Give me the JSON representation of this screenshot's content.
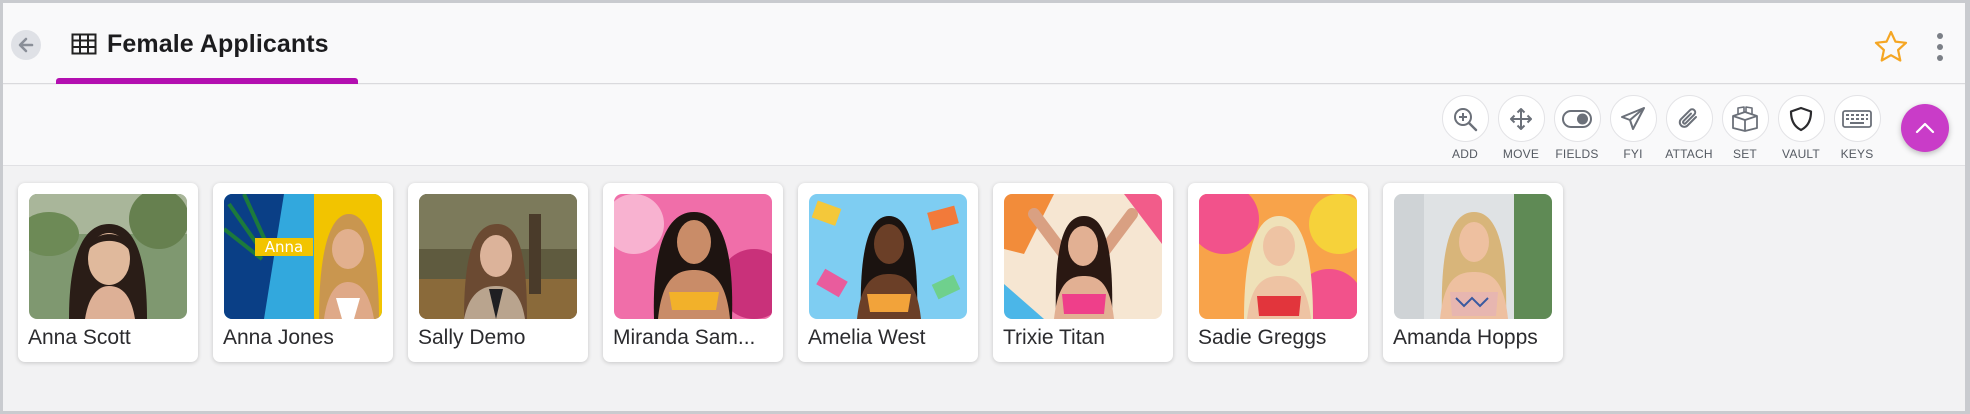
{
  "header": {
    "title": "Female Applicants",
    "icons": {
      "back": "arrow-left-icon",
      "table": "table-grid-icon",
      "star": "star-outline-icon",
      "more": "kebab-menu-icon"
    },
    "colors": {
      "accent": "#b30fb0",
      "star": "#f5a623"
    }
  },
  "toolbar": {
    "actions": [
      {
        "label": "ADD",
        "icon": "zoom-in-icon"
      },
      {
        "label": "MOVE",
        "icon": "move-arrows-icon"
      },
      {
        "label": "FIELDS",
        "icon": "toggle-icon"
      },
      {
        "label": "FYI",
        "icon": "paper-plane-icon"
      },
      {
        "label": "ATTACH",
        "icon": "paperclip-icon"
      },
      {
        "label": "SET",
        "icon": "boxes-icon"
      },
      {
        "label": "VAULT",
        "icon": "shield-icon"
      },
      {
        "label": "KEYS",
        "icon": "keyboard-icon"
      }
    ],
    "fab_icon": "chevron-up-icon",
    "fab_color": "#c93cc8"
  },
  "cards": [
    {
      "name": "Anna Scott"
    },
    {
      "name": "Anna Jones",
      "photo_caption": "Anna"
    },
    {
      "name": "Sally Demo"
    },
    {
      "name": "Miranda Sam..."
    },
    {
      "name": "Amelia West"
    },
    {
      "name": "Trixie Titan"
    },
    {
      "name": "Sadie Greggs"
    },
    {
      "name": "Amanda Hopps"
    }
  ]
}
